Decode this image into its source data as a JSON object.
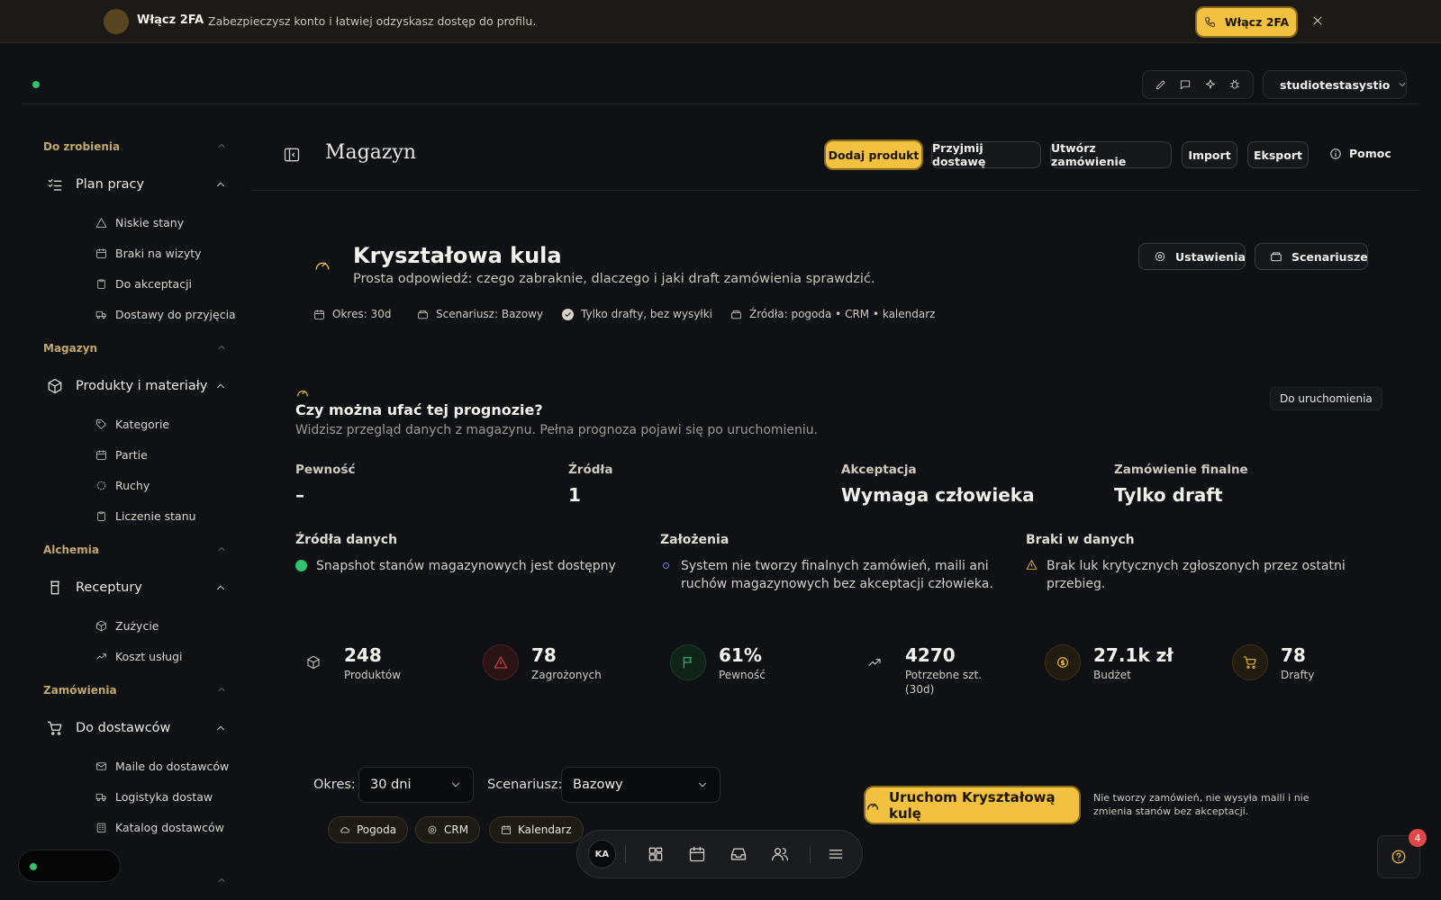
{
  "banner": {
    "title": "Włącz 2FA",
    "text": "Zabezpieczysz konto i łatwiej odzyskasz dostęp do profilu.",
    "button_label": "Włącz 2FA"
  },
  "workspace": {
    "name": "studiotestasystio"
  },
  "sidebar": {
    "sections": [
      {
        "label": "Do zrobienia",
        "group": "Plan pracy",
        "items": [
          "Niskie stany",
          "Braki na wizyty",
          "Do akceptacji",
          "Dostawy do przyjęcia"
        ]
      },
      {
        "label": "Magazyn",
        "group": "Produkty i materiały",
        "items": [
          "Kategorie",
          "Partie",
          "Ruchy",
          "Liczenie stanu"
        ]
      },
      {
        "label": "Alchemia",
        "group": "Receptury",
        "items": [
          "Zużycie",
          "Koszt usługi"
        ]
      },
      {
        "label": "Zamówienia",
        "group": "Do dostawców",
        "items": [
          "Maile do dostawców",
          "Logistyka dostaw",
          "Katalog dostawców"
        ]
      }
    ]
  },
  "header": {
    "title": "Magazyn",
    "buttons": [
      "Dodaj produkt",
      "Przyjmij dostawę",
      "Utwórz zamówienie",
      "Import",
      "Eksport"
    ],
    "help": "Pomoc"
  },
  "hero": {
    "title": "Kryształowa kula",
    "subtitle": "Prosta odpowiedź: czego zabraknie, dlaczego i jaki draft zamówienia sprawdzić.",
    "settings_label": "Ustawienia",
    "scenarios_label": "Scenariusze",
    "meta": [
      "Okres: 30d",
      "Scenariusz: Bazowy",
      "Tylko drafty, bez wysyłki",
      "Źródła: pogoda • CRM • kalendarz"
    ]
  },
  "forecast": {
    "title": "Czy można ufać tej prognozie?",
    "subtitle": "Widzisz przegląd danych z magazynu. Pełna prognoza pojawi się po uruchomieniu.",
    "badge": "Do uruchomienia",
    "kpis": [
      {
        "label": "Pewność",
        "value": "–"
      },
      {
        "label": "Źródła",
        "value": "1"
      },
      {
        "label": "Akceptacja",
        "value": "Wymaga człowieka"
      },
      {
        "label": "Zamówienie finalne",
        "value": "Tylko draft"
      }
    ],
    "columns": [
      {
        "heading": "Źródła danych",
        "text": "Snapshot stanów magazynowych jest dostępny"
      },
      {
        "heading": "Założenia",
        "text": "System nie tworzy finalnych zamówień, maili ani ruchów magazynowych bez akceptacji człowieka."
      },
      {
        "heading": "Braki w danych",
        "text": "Brak luk krytycznych zgłoszonych przez ostatni przebieg."
      }
    ]
  },
  "stats": [
    {
      "value": "248",
      "label": "Produktów",
      "icon": "cube-icon"
    },
    {
      "value": "78",
      "label": "Zagrożonych",
      "icon": "warning-icon"
    },
    {
      "value": "61%",
      "label": "Pewność",
      "icon": "flag-icon"
    },
    {
      "value": "4270",
      "label": "Potrzebne szt.\n(30d)",
      "icon": "trend-up-icon"
    },
    {
      "value": "27.1k zł",
      "label": "Budżet",
      "icon": "coin-icon"
    },
    {
      "value": "78",
      "label": "Drafty",
      "icon": "cart-icon"
    }
  ],
  "controls": {
    "period_label": "Okres:",
    "period_value": "30 dni",
    "scenario_label": "Scenariusz:",
    "scenario_value": "Bazowy",
    "chips": [
      "Pogoda",
      "CRM",
      "Kalendarz"
    ],
    "run_label": "Uruchom Kryształową kulę",
    "run_note": "Nie tworzy zamówień, nie wysyła maili i nie zmienia stanów bez akceptacji."
  },
  "dock": {
    "avatar": "KA"
  },
  "help_widget": {
    "count": "4"
  },
  "colors": {
    "accent": "#f2c13f",
    "success": "#31c46f",
    "danger": "#e04848",
    "background": "#0f1114"
  }
}
